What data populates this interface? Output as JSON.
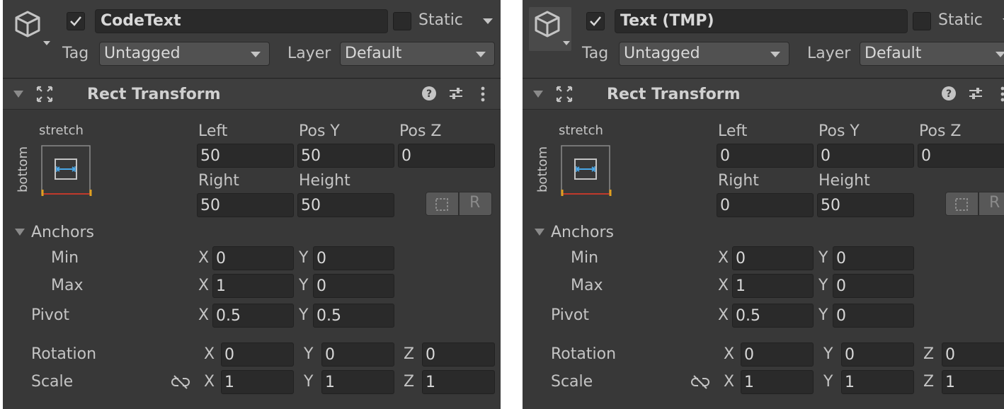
{
  "panels": [
    {
      "object_name": "CodeText",
      "active": true,
      "static_label": "Static",
      "tag_label": "Tag",
      "tag_value": "Untagged",
      "layer_label": "Layer",
      "layer_value": "Default",
      "component_title": "Rect Transform",
      "anchor_preset": {
        "horizontal": "stretch",
        "vertical": "bottom"
      },
      "labels": {
        "left": "Left",
        "pos_y": "Pos Y",
        "pos_z": "Pos Z",
        "right": "Right",
        "height": "Height",
        "anchors": "Anchors",
        "min": "Min",
        "max": "Max",
        "pivot": "Pivot",
        "rotation": "Rotation",
        "scale": "Scale",
        "x": "X",
        "y": "Y",
        "z": "Z"
      },
      "values": {
        "left": "50",
        "pos_y": "50",
        "pos_z": "0",
        "right": "50",
        "height": "50",
        "min_x": "0",
        "min_y": "0",
        "max_x": "1",
        "max_y": "0",
        "pivot_x": "0.5",
        "pivot_y": "0.5",
        "rot_x": "0",
        "rot_y": "0",
        "rot_z": "0",
        "scale_x": "1",
        "scale_y": "1",
        "scale_z": "1"
      }
    },
    {
      "object_name": "Text (TMP)",
      "active": true,
      "static_label": "Static",
      "tag_label": "Tag",
      "tag_value": "Untagged",
      "layer_label": "Layer",
      "layer_value": "Default",
      "component_title": "Rect Transform",
      "anchor_preset": {
        "horizontal": "stretch",
        "vertical": "bottom"
      },
      "labels": {
        "left": "Left",
        "pos_y": "Pos Y",
        "pos_z": "Pos Z",
        "right": "Right",
        "height": "Height",
        "anchors": "Anchors",
        "min": "Min",
        "max": "Max",
        "pivot": "Pivot",
        "rotation": "Rotation",
        "scale": "Scale",
        "x": "X",
        "y": "Y",
        "z": "Z"
      },
      "values": {
        "left": "0",
        "pos_y": "0",
        "pos_z": "0",
        "right": "0",
        "height": "50",
        "min_x": "0",
        "min_y": "0",
        "max_x": "1",
        "max_y": "0",
        "pivot_x": "0.5",
        "pivot_y": "0",
        "rot_x": "0",
        "rot_y": "0",
        "rot_z": "0",
        "scale_x": "1",
        "scale_y": "1",
        "scale_z": "1"
      }
    }
  ],
  "icons": [
    "gameobject-cube-icon",
    "checkmark-icon",
    "foldout-arrow-icon",
    "rect-transform-icon",
    "help-icon",
    "presets-icon",
    "kebab-menu-icon",
    "blueprint-mode-icon",
    "raw-edit-icon",
    "scale-link-icon"
  ],
  "colors": {
    "panel_bg": "#383838",
    "field_bg": "#2a2a2a",
    "anchor_blue": "#4aa8e8",
    "anchor_orange": "#e0a020",
    "anchor_red": "#c0392b"
  }
}
